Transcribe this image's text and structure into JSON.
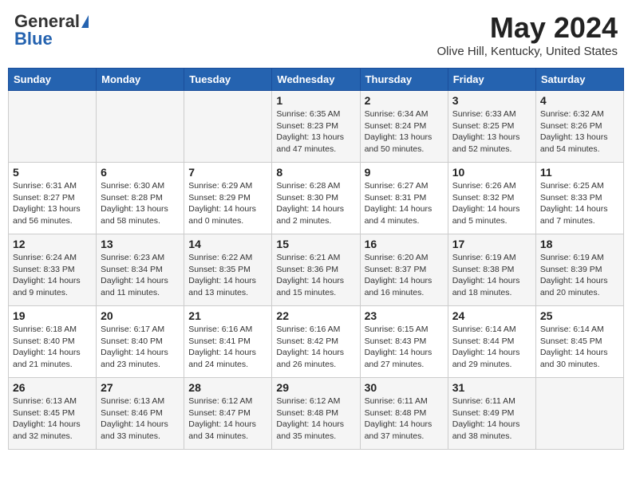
{
  "header": {
    "logo_general": "General",
    "logo_blue": "Blue",
    "month_title": "May 2024",
    "location": "Olive Hill, Kentucky, United States"
  },
  "days_of_week": [
    "Sunday",
    "Monday",
    "Tuesday",
    "Wednesday",
    "Thursday",
    "Friday",
    "Saturday"
  ],
  "weeks": [
    [
      {
        "day": "",
        "info": ""
      },
      {
        "day": "",
        "info": ""
      },
      {
        "day": "",
        "info": ""
      },
      {
        "day": "1",
        "info": "Sunrise: 6:35 AM\nSunset: 8:23 PM\nDaylight: 13 hours\nand 47 minutes."
      },
      {
        "day": "2",
        "info": "Sunrise: 6:34 AM\nSunset: 8:24 PM\nDaylight: 13 hours\nand 50 minutes."
      },
      {
        "day": "3",
        "info": "Sunrise: 6:33 AM\nSunset: 8:25 PM\nDaylight: 13 hours\nand 52 minutes."
      },
      {
        "day": "4",
        "info": "Sunrise: 6:32 AM\nSunset: 8:26 PM\nDaylight: 13 hours\nand 54 minutes."
      }
    ],
    [
      {
        "day": "5",
        "info": "Sunrise: 6:31 AM\nSunset: 8:27 PM\nDaylight: 13 hours\nand 56 minutes."
      },
      {
        "day": "6",
        "info": "Sunrise: 6:30 AM\nSunset: 8:28 PM\nDaylight: 13 hours\nand 58 minutes."
      },
      {
        "day": "7",
        "info": "Sunrise: 6:29 AM\nSunset: 8:29 PM\nDaylight: 14 hours\nand 0 minutes."
      },
      {
        "day": "8",
        "info": "Sunrise: 6:28 AM\nSunset: 8:30 PM\nDaylight: 14 hours\nand 2 minutes."
      },
      {
        "day": "9",
        "info": "Sunrise: 6:27 AM\nSunset: 8:31 PM\nDaylight: 14 hours\nand 4 minutes."
      },
      {
        "day": "10",
        "info": "Sunrise: 6:26 AM\nSunset: 8:32 PM\nDaylight: 14 hours\nand 5 minutes."
      },
      {
        "day": "11",
        "info": "Sunrise: 6:25 AM\nSunset: 8:33 PM\nDaylight: 14 hours\nand 7 minutes."
      }
    ],
    [
      {
        "day": "12",
        "info": "Sunrise: 6:24 AM\nSunset: 8:33 PM\nDaylight: 14 hours\nand 9 minutes."
      },
      {
        "day": "13",
        "info": "Sunrise: 6:23 AM\nSunset: 8:34 PM\nDaylight: 14 hours\nand 11 minutes."
      },
      {
        "day": "14",
        "info": "Sunrise: 6:22 AM\nSunset: 8:35 PM\nDaylight: 14 hours\nand 13 minutes."
      },
      {
        "day": "15",
        "info": "Sunrise: 6:21 AM\nSunset: 8:36 PM\nDaylight: 14 hours\nand 15 minutes."
      },
      {
        "day": "16",
        "info": "Sunrise: 6:20 AM\nSunset: 8:37 PM\nDaylight: 14 hours\nand 16 minutes."
      },
      {
        "day": "17",
        "info": "Sunrise: 6:19 AM\nSunset: 8:38 PM\nDaylight: 14 hours\nand 18 minutes."
      },
      {
        "day": "18",
        "info": "Sunrise: 6:19 AM\nSunset: 8:39 PM\nDaylight: 14 hours\nand 20 minutes."
      }
    ],
    [
      {
        "day": "19",
        "info": "Sunrise: 6:18 AM\nSunset: 8:40 PM\nDaylight: 14 hours\nand 21 minutes."
      },
      {
        "day": "20",
        "info": "Sunrise: 6:17 AM\nSunset: 8:40 PM\nDaylight: 14 hours\nand 23 minutes."
      },
      {
        "day": "21",
        "info": "Sunrise: 6:16 AM\nSunset: 8:41 PM\nDaylight: 14 hours\nand 24 minutes."
      },
      {
        "day": "22",
        "info": "Sunrise: 6:16 AM\nSunset: 8:42 PM\nDaylight: 14 hours\nand 26 minutes."
      },
      {
        "day": "23",
        "info": "Sunrise: 6:15 AM\nSunset: 8:43 PM\nDaylight: 14 hours\nand 27 minutes."
      },
      {
        "day": "24",
        "info": "Sunrise: 6:14 AM\nSunset: 8:44 PM\nDaylight: 14 hours\nand 29 minutes."
      },
      {
        "day": "25",
        "info": "Sunrise: 6:14 AM\nSunset: 8:45 PM\nDaylight: 14 hours\nand 30 minutes."
      }
    ],
    [
      {
        "day": "26",
        "info": "Sunrise: 6:13 AM\nSunset: 8:45 PM\nDaylight: 14 hours\nand 32 minutes."
      },
      {
        "day": "27",
        "info": "Sunrise: 6:13 AM\nSunset: 8:46 PM\nDaylight: 14 hours\nand 33 minutes."
      },
      {
        "day": "28",
        "info": "Sunrise: 6:12 AM\nSunset: 8:47 PM\nDaylight: 14 hours\nand 34 minutes."
      },
      {
        "day": "29",
        "info": "Sunrise: 6:12 AM\nSunset: 8:48 PM\nDaylight: 14 hours\nand 35 minutes."
      },
      {
        "day": "30",
        "info": "Sunrise: 6:11 AM\nSunset: 8:48 PM\nDaylight: 14 hours\nand 37 minutes."
      },
      {
        "day": "31",
        "info": "Sunrise: 6:11 AM\nSunset: 8:49 PM\nDaylight: 14 hours\nand 38 minutes."
      },
      {
        "day": "",
        "info": ""
      }
    ]
  ]
}
